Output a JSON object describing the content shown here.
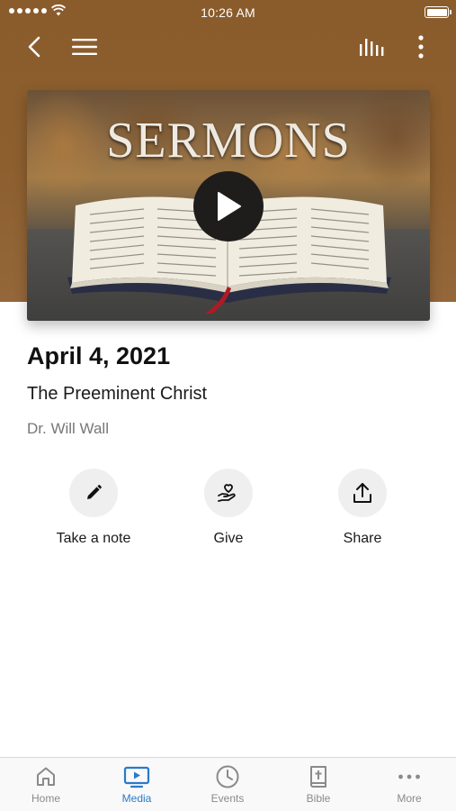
{
  "status_bar": {
    "time": "10:26 AM"
  },
  "hero": {
    "title": "SERMONS"
  },
  "sermon": {
    "date": "April 4, 2021",
    "title": "The Preeminent Christ",
    "speaker": "Dr. Will Wall"
  },
  "actions": [
    {
      "label": "Take a note",
      "icon": "pencil-icon"
    },
    {
      "label": "Give",
      "icon": "hand-heart-icon"
    },
    {
      "label": "Share",
      "icon": "share-icon"
    }
  ],
  "tabs": [
    {
      "label": "Home",
      "icon": "home-icon",
      "active": false
    },
    {
      "label": "Media",
      "icon": "media-icon",
      "active": true
    },
    {
      "label": "Events",
      "icon": "clock-icon",
      "active": false
    },
    {
      "label": "Bible",
      "icon": "bible-icon",
      "active": false
    },
    {
      "label": "More",
      "icon": "more-icon",
      "active": false
    }
  ],
  "colors": {
    "header_brown": "#8d5f2f",
    "active_tab": "#2a7ac9",
    "inactive_tab": "#8a8a8a",
    "action_circle": "#efefef"
  }
}
